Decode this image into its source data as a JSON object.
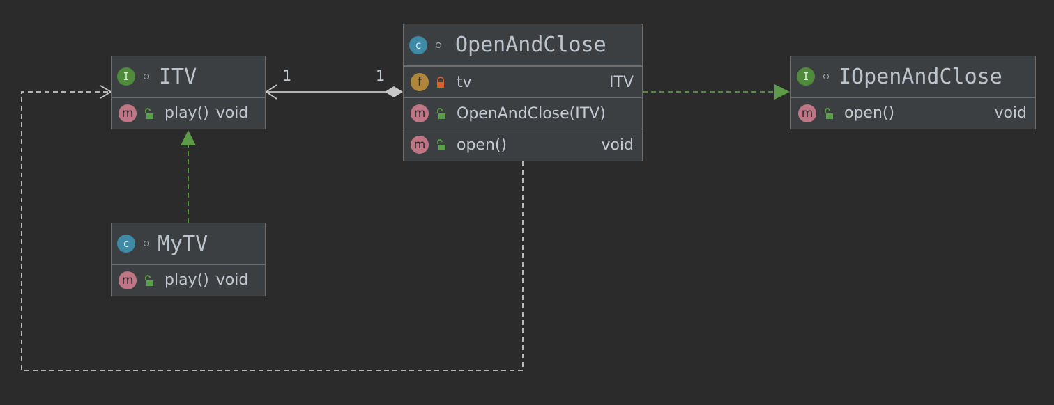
{
  "diagram": {
    "classes": {
      "itv": {
        "kind_letter": "I",
        "name": "ITV",
        "methods": [
          {
            "badge": "m",
            "name": "play()",
            "type": "void"
          }
        ]
      },
      "mytv": {
        "kind_letter": "c",
        "name": "MyTV",
        "methods": [
          {
            "badge": "m",
            "name": "play()",
            "type": "void"
          }
        ]
      },
      "openandclose": {
        "kind_letter": "c",
        "name": "OpenAndClose",
        "fields": [
          {
            "badge": "f",
            "name": "tv",
            "type": "ITV"
          }
        ],
        "constructors": [
          {
            "badge": "m",
            "name": "OpenAndClose(ITV)"
          }
        ],
        "methods": [
          {
            "badge": "m",
            "name": "open()",
            "type": "void"
          }
        ]
      },
      "iopenandclose": {
        "kind_letter": "I",
        "name": "IOpenAndClose",
        "methods": [
          {
            "badge": "m",
            "name": "open()",
            "type": "void"
          }
        ]
      }
    },
    "relations": {
      "aggregation": {
        "source_multiplicity": "1",
        "target_multiplicity": "1"
      }
    },
    "colors": {
      "background": "#2b2b2b",
      "box": "#3c3f41",
      "border": "#6d6d6d",
      "interface_badge": "#4f8a3d",
      "class_badge": "#3f8aa4",
      "method_badge": "#c07585",
      "field_badge": "#b0873a",
      "public_lock": "#59a047",
      "private_lock": "#d8622f",
      "realization_edge": "#5d9b48",
      "dependency_edge": "#c8c8c8"
    }
  }
}
